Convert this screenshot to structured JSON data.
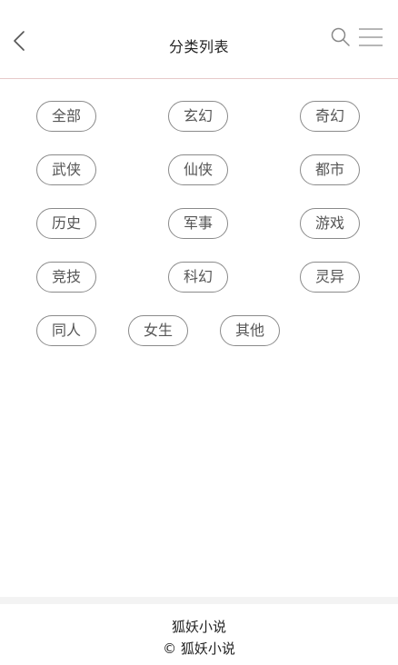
{
  "header": {
    "title": "分类列表"
  },
  "categories": [
    "全部",
    "玄幻",
    "奇幻",
    "武侠",
    "仙侠",
    "都市",
    "历史",
    "军事",
    "游戏",
    "竞技",
    "科幻",
    "灵异",
    "同人",
    "女生",
    "其他"
  ],
  "footer": {
    "brand": "狐妖小说",
    "copyright": "© 狐妖小说"
  },
  "colors": {
    "header_border": "#e7c9c9",
    "pill_border": "#8a8a8a",
    "text": "#555555"
  }
}
